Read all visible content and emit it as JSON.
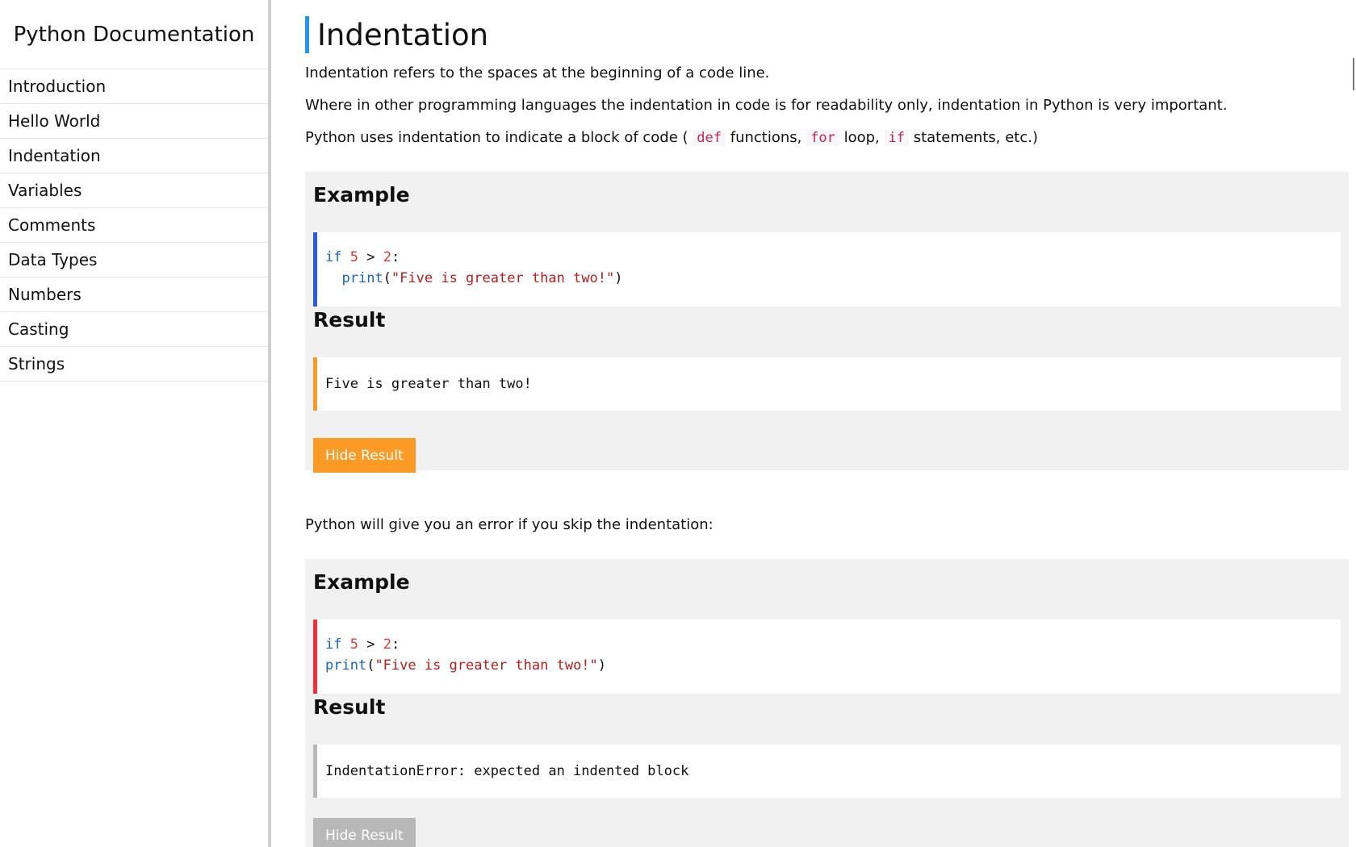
{
  "sidebar": {
    "title": "Python Documentation",
    "items": [
      {
        "label": "Introduction"
      },
      {
        "label": "Hello World"
      },
      {
        "label": "Indentation"
      },
      {
        "label": "Variables"
      },
      {
        "label": "Comments"
      },
      {
        "label": "Data Types"
      },
      {
        "label": "Numbers"
      },
      {
        "label": "Casting"
      },
      {
        "label": "Strings"
      }
    ]
  },
  "main": {
    "heading": "Indentation",
    "p1": "Indentation refers to the spaces at the beginning of a code line.",
    "p2": "Where in other programming languages the indentation in code is for readability only, indentation in Python is very important.",
    "p3_before": "Python uses indentation to indicate a block of code (",
    "p3_kw1": "def",
    "p3_mid1": "functions,",
    "p3_kw2": "for",
    "p3_mid2": "loop,",
    "p3_kw3": "if",
    "p3_after": "statements, etc.)",
    "p4": "Python will give you an error if you skip the indentation:",
    "example1": {
      "label": "Example",
      "code": {
        "kw_if": "if",
        "num1": "5",
        "op": ">",
        "num2": "2",
        "colon": ":",
        "fn": "print",
        "open": "(",
        "str": "\"Five is greater than two!\"",
        "close": ")"
      },
      "result_label": "Result",
      "result": "Five is greater than two!",
      "button": "Hide Result"
    },
    "example2": {
      "label": "Example",
      "code": {
        "kw_if": "if",
        "num1": "5",
        "op": ">",
        "num2": "2",
        "colon": ":",
        "fn": "print",
        "open": "(",
        "str": "\"Five is greater than two!\"",
        "close": ")"
      },
      "result_label": "Result",
      "result": "IndentationError: expected an indented block",
      "button": "Hide Result"
    }
  },
  "colors": {
    "heading_accent": "#2196f3",
    "example1_border": "#2e5bdb",
    "example2_border": "#f0303b",
    "result1_border": "#fb9a24",
    "result2_border": "#b8b8b8",
    "button_active": "#fb9a24",
    "button_disabled": "#b8b8b8"
  }
}
